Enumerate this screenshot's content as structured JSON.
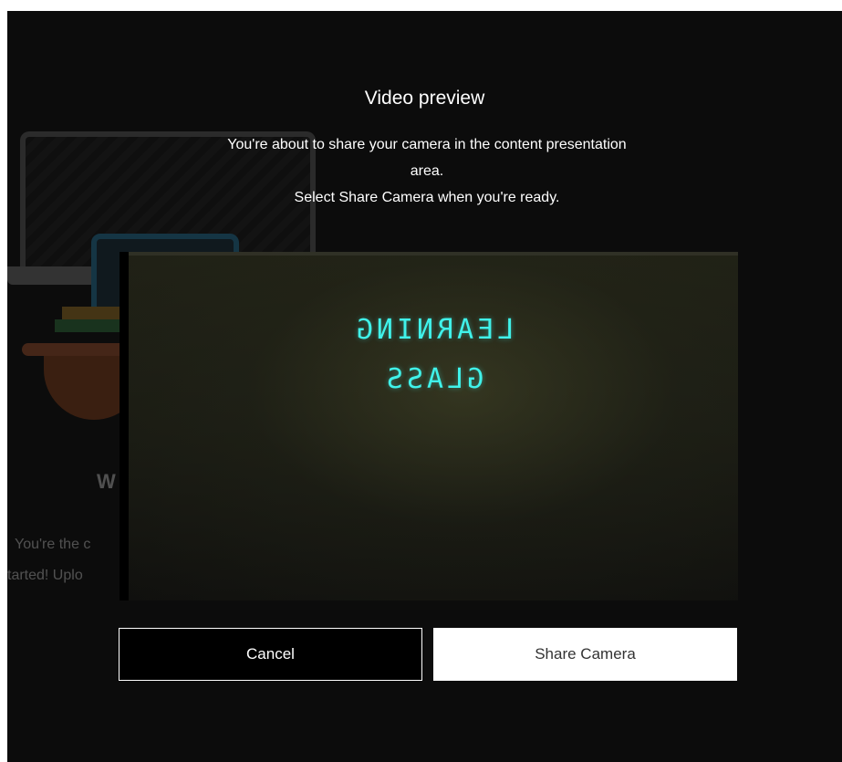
{
  "background": {
    "heading_fragment": "W",
    "line1_fragment": "You're the c",
    "line2_fragment": "tarted! Uplo"
  },
  "dialog": {
    "title": "Video preview",
    "description_line1": "You're about to share your camera in the content presentation",
    "description_line2": "area.",
    "description_line3": "Select Share Camera when you're ready.",
    "preview": {
      "board_line1": "LEARNING",
      "board_line2": "GLASS"
    },
    "buttons": {
      "cancel_label": "Cancel",
      "share_label": "Share Camera"
    }
  },
  "colors": {
    "backdrop": "#0c0c0c",
    "board_text": "#40f2ea",
    "primary_button": "#ffffff"
  }
}
